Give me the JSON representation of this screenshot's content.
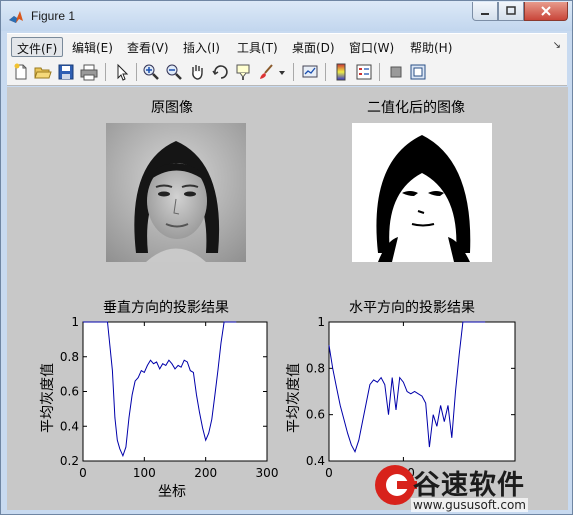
{
  "window": {
    "title": "Figure 1"
  },
  "menu": [
    "文件(F)",
    "编辑(E)",
    "查看(V)",
    "插入(I)",
    "工具(T)",
    "桌面(D)",
    "窗口(W)",
    "帮助(H)"
  ],
  "toolbar_icons": [
    "new-file-icon",
    "open-folder-icon",
    "save-icon",
    "print-icon",
    "arrow-pointer-icon",
    "zoom-in-icon",
    "zoom-out-icon",
    "pan-hand-icon",
    "rotate-3d-icon",
    "data-cursor-icon",
    "brush-icon",
    "brush-dropdown-icon",
    "link-plot-icon",
    "colorbar-icon",
    "legend-icon",
    "hide-plot-tools-icon",
    "show-plot-tools-icon"
  ],
  "images": [
    {
      "title": "原图像"
    },
    {
      "title": "二值化后的图像"
    }
  ],
  "chart_data": [
    {
      "type": "line",
      "title": "垂直方向的投影结果",
      "xlabel": "坐标",
      "ylabel": "平均灰度值",
      "xlim": [
        0,
        300
      ],
      "ylim": [
        0.2,
        1
      ],
      "xticks": [
        "0",
        "100",
        "200",
        "300"
      ],
      "yticks": [
        "0.2",
        "0.4",
        "0.6",
        "0.8",
        "1"
      ],
      "line_color": "#0000aa",
      "x": [
        0,
        20,
        40,
        48,
        52,
        56,
        60,
        65,
        70,
        75,
        80,
        85,
        90,
        95,
        100,
        105,
        110,
        115,
        120,
        125,
        130,
        135,
        140,
        145,
        150,
        155,
        160,
        165,
        170,
        175,
        180,
        185,
        190,
        195,
        200,
        205,
        210,
        215,
        220,
        225,
        230,
        235,
        240,
        250
      ],
      "y": [
        1,
        1,
        1,
        0.72,
        0.45,
        0.32,
        0.27,
        0.23,
        0.28,
        0.45,
        0.58,
        0.66,
        0.68,
        0.72,
        0.71,
        0.75,
        0.78,
        0.76,
        0.77,
        0.73,
        0.76,
        0.75,
        0.78,
        0.76,
        0.73,
        0.75,
        0.74,
        0.78,
        0.77,
        0.72,
        0.71,
        0.58,
        0.48,
        0.39,
        0.32,
        0.36,
        0.44,
        0.58,
        0.72,
        0.88,
        1,
        1,
        1,
        1
      ]
    },
    {
      "type": "line",
      "title": "水平方向的投影结果",
      "xlabel": "",
      "ylabel": "平均灰度值",
      "xlim": [
        0,
        250
      ],
      "ylim": [
        0.4,
        1
      ],
      "xticks": [
        "0",
        "100"
      ],
      "yticks": [
        "0.4",
        "0.6",
        "0.8",
        "1"
      ],
      "line_color": "#0000aa",
      "x": [
        0,
        5,
        10,
        15,
        20,
        25,
        30,
        35,
        40,
        45,
        50,
        55,
        60,
        65,
        70,
        75,
        80,
        85,
        90,
        95,
        100,
        105,
        110,
        115,
        120,
        125,
        130,
        135,
        140,
        145,
        150,
        155,
        160,
        165,
        170,
        175,
        180,
        185,
        190,
        195,
        200,
        205,
        210
      ],
      "y": [
        0.9,
        0.8,
        0.72,
        0.64,
        0.58,
        0.52,
        0.47,
        0.44,
        0.49,
        0.57,
        0.65,
        0.73,
        0.75,
        0.74,
        0.76,
        0.73,
        0.6,
        0.76,
        0.62,
        0.76,
        0.74,
        0.7,
        0.69,
        0.7,
        0.69,
        0.68,
        0.65,
        0.46,
        0.6,
        0.55,
        0.64,
        0.57,
        0.64,
        0.5,
        0.7,
        0.86,
        1,
        1,
        1,
        1,
        1,
        1,
        1
      ]
    }
  ],
  "watermark": {
    "text": "谷速软件",
    "url": "www.gususoft.com"
  }
}
